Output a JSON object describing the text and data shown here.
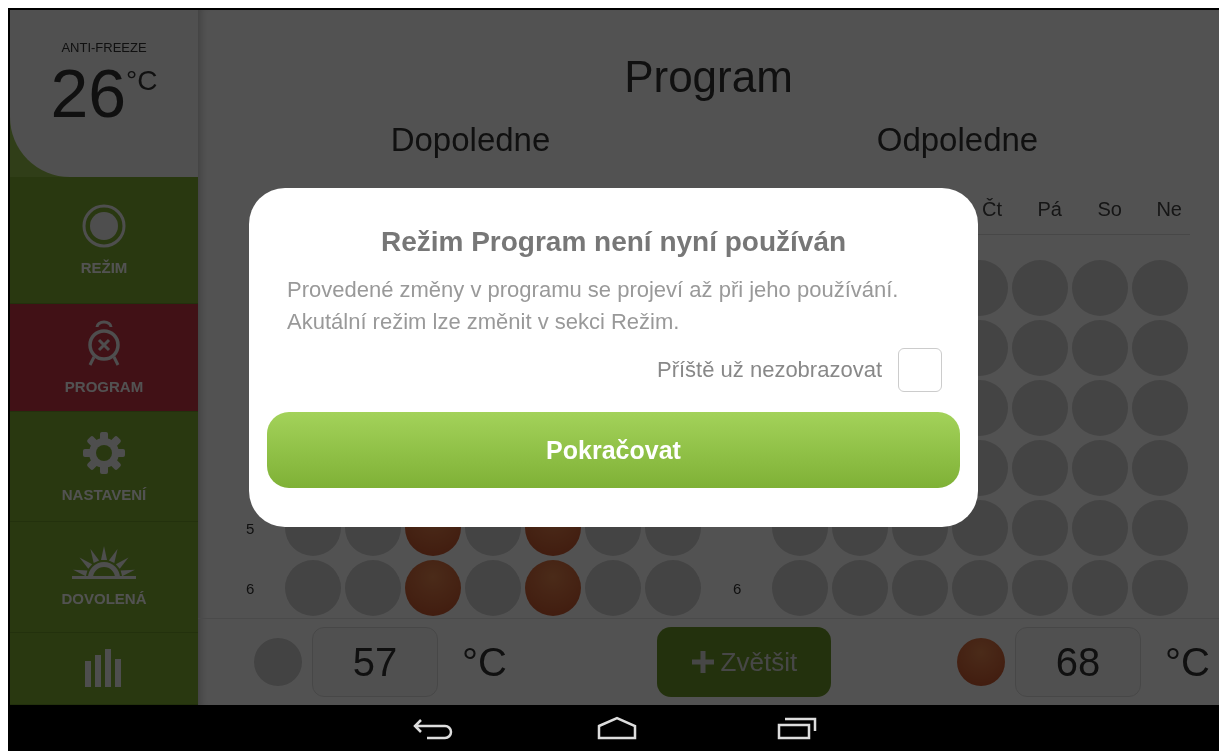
{
  "sidebar": {
    "mode_label": "ANTI-FREEZE",
    "temperature": "26",
    "unit": "°C",
    "items": [
      {
        "kind": "mode",
        "label": "REŽIM",
        "selected": false
      },
      {
        "kind": "alarm",
        "label": "PROGRAM",
        "selected": true
      },
      {
        "kind": "gear",
        "label": "NASTAVENÍ",
        "selected": false
      },
      {
        "kind": "sun",
        "label": "DOVOLENÁ",
        "selected": false
      },
      {
        "kind": "stats",
        "selected": false
      }
    ]
  },
  "header": {
    "title": "Program"
  },
  "panels": [
    {
      "title": "Dopoledne",
      "rows": [
        {
          "cells": []
        },
        {
          "cells": []
        },
        {
          "cells": []
        },
        {
          "cells": []
        },
        {
          "hour": "5",
          "cells": [
            false,
            false,
            true,
            false,
            true,
            false,
            false
          ]
        },
        {
          "hour": "6",
          "cells": [
            false,
            false,
            true,
            false,
            true,
            false,
            false
          ]
        }
      ]
    },
    {
      "title": "Odpoledne",
      "days": [
        "Čt",
        "Pá",
        "So",
        "Ne"
      ],
      "rows": [
        {
          "cells": [
            false,
            false,
            false,
            false
          ]
        },
        {
          "cells": [
            false,
            false,
            false,
            false
          ]
        },
        {
          "cells": [
            false,
            false,
            false,
            false
          ]
        },
        {
          "cells": [
            false,
            false,
            false,
            false
          ]
        },
        {
          "cells": [
            false,
            false,
            false,
            false,
            false,
            false,
            false
          ]
        },
        {
          "hour": "6",
          "cells": [
            false,
            false,
            false,
            false,
            false,
            false,
            false
          ]
        }
      ]
    }
  ],
  "footer": {
    "left": {
      "on": false,
      "value": "57",
      "unit": "°C"
    },
    "zoom_button": "Zvětšit",
    "right": {
      "on": true,
      "value": "68",
      "unit": "°C"
    }
  },
  "dialog": {
    "title": "Režim Program není nyní používán",
    "message": "Provedené změny v programu se projeví až při jeho používání. Akutální režim lze změnit v sekci Režim.",
    "checkbox": {
      "label": "Příště už nezobrazovat",
      "checked": false
    },
    "button": "Pokračovat"
  }
}
